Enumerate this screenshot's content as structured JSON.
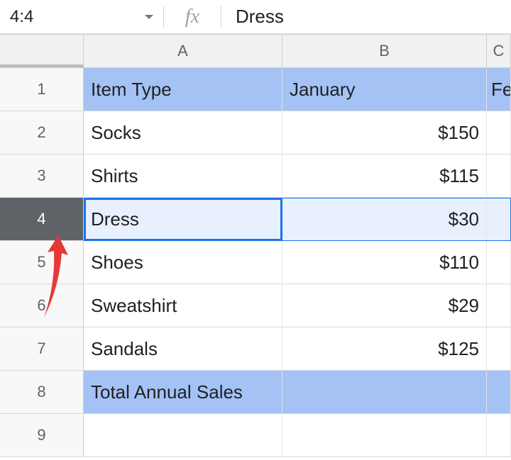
{
  "nameBox": "4:4",
  "formulaValue": "Dress",
  "fxLabel": "fx",
  "columns": {
    "A": "A",
    "B": "B",
    "C": "C"
  },
  "rows": {
    "1": {
      "num": "1",
      "A": "Item Type",
      "B": "January",
      "C": "Fe"
    },
    "2": {
      "num": "2",
      "A": "Socks",
      "B": "$150",
      "C": ""
    },
    "3": {
      "num": "3",
      "A": "Shirts",
      "B": "$115",
      "C": ""
    },
    "4": {
      "num": "4",
      "A": "Dress",
      "B": "$30",
      "C": ""
    },
    "5": {
      "num": "5",
      "A": "Shoes",
      "B": "$110",
      "C": ""
    },
    "6": {
      "num": "6",
      "A": "Sweatshirt",
      "B": "$29",
      "C": ""
    },
    "7": {
      "num": "7",
      "A": "Sandals",
      "B": "$125",
      "C": ""
    },
    "8": {
      "num": "8",
      "A": "Total Annual Sales",
      "B": "",
      "C": ""
    },
    "9": {
      "num": "9",
      "A": "",
      "B": "",
      "C": ""
    }
  },
  "chart_data": {
    "type": "table",
    "title": "",
    "columns": [
      "Item Type",
      "January"
    ],
    "rows": [
      [
        "Socks",
        150
      ],
      [
        "Shirts",
        115
      ],
      [
        "Dress",
        30
      ],
      [
        "Shoes",
        110
      ],
      [
        "Sweatshirt",
        29
      ],
      [
        "Sandals",
        125
      ]
    ],
    "footer": [
      "Total Annual Sales",
      null
    ]
  }
}
